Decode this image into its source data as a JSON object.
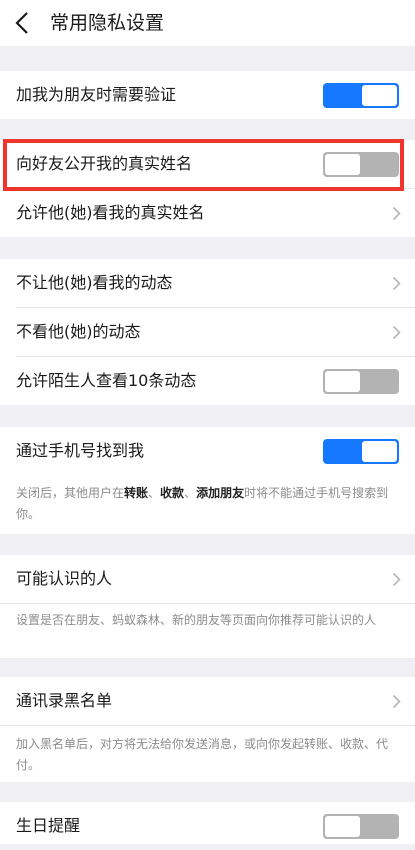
{
  "header": {
    "title": "常用隐私设置",
    "back_icon": "back-chevron-icon"
  },
  "rows": {
    "verify_friend": {
      "label": "加我为朋友时需要验证",
      "toggle": "on"
    },
    "show_real_name": {
      "label": "向好友公开我的真实姓名",
      "toggle": "off"
    },
    "allow_see_real_name": {
      "label": "允许他(她)看我的真实姓名"
    },
    "block_see_feed": {
      "label": "不让他(她)看我的动态"
    },
    "hide_their_feed": {
      "label": "不看他(她)的动态"
    },
    "stranger_view_10": {
      "label": "允许陌生人查看10条动态",
      "toggle": "off"
    },
    "find_by_phone": {
      "label": "通过手机号找到我",
      "toggle": "on"
    },
    "find_by_phone_note": {
      "part1": "关闭后，其他用户在",
      "bold1": "转账",
      "sep1": "、",
      "bold2": "收款",
      "sep2": "、",
      "bold3": "添加朋友",
      "part2": "时将不能通过手机号搜索到你。"
    },
    "people_may_know": {
      "label": "可能认识的人"
    },
    "people_may_know_note": "设置是否在朋友、蚂蚁森林、新的朋友等页面向你推荐可能认识的人",
    "blacklist": {
      "label": "通讯录黑名单"
    },
    "blacklist_note": "加入黑名单后，对方将无法给你发送消息，或向你发起转账、收款、代付。",
    "birthday_reminder": {
      "label": "生日提醒",
      "toggle": "off"
    }
  },
  "colors": {
    "accent": "#1677ff",
    "highlight": "#f0352f",
    "toggle_off": "#b3b3b3"
  }
}
